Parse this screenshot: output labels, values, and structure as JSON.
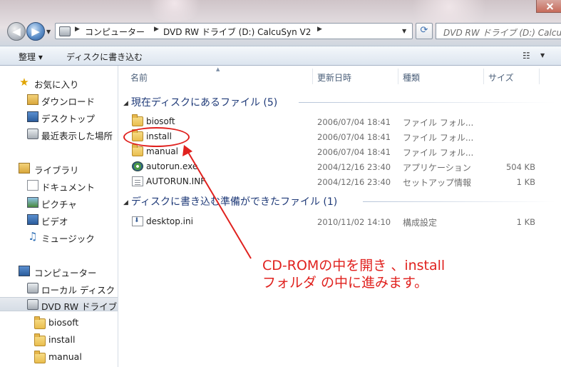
{
  "window": {
    "close_glyph": "close-icon"
  },
  "nav_buttons": {
    "back": "back-arrow-icon",
    "forward": "forward-arrow-icon"
  },
  "address_bar": {
    "crumbs": [
      "コンピューター",
      "DVD RW ドライブ (D:) CalcuSyn V2"
    ]
  },
  "search": {
    "placeholder": "DVD RW ドライブ (D:) Calcu"
  },
  "command_bar": {
    "organize": "整理 ▾",
    "burn": "ディスクに書き込む"
  },
  "nav_pane": {
    "favorites": "お気に入り",
    "favorites_items": [
      "ダウンロード",
      "デスクトップ",
      "最近表示した場所"
    ],
    "libraries": "ライブラリ",
    "library_items": [
      "ドキュメント",
      "ピクチャ",
      "ビデオ",
      "ミュージック"
    ],
    "computer": "コンピューター",
    "computer_items": [
      "ローカル ディスク (",
      "DVD RW ドライブ"
    ],
    "dvd_children": [
      "biosoft",
      "install",
      "manual"
    ]
  },
  "columns": {
    "name": "名前",
    "date": "更新日時",
    "type": "種類",
    "size": "サイズ"
  },
  "groups": [
    {
      "title": "現在ディスクにあるファイル (5)",
      "files": [
        {
          "name": "biosoft",
          "date": "2006/07/04 18:41",
          "type": "ファイル フォル...",
          "size": "",
          "icon": "folder"
        },
        {
          "name": "install",
          "date": "2006/07/04 18:41",
          "type": "ファイル フォル...",
          "size": "",
          "icon": "folder"
        },
        {
          "name": "manual",
          "date": "2006/07/04 18:41",
          "type": "ファイル フォル...",
          "size": "",
          "icon": "folder"
        },
        {
          "name": "autorun.exe",
          "date": "2004/12/16 23:40",
          "type": "アプリケーション",
          "size": "504 KB",
          "icon": "exe"
        },
        {
          "name": "AUTORUN.INF",
          "date": "2004/12/16 23:40",
          "type": "セットアップ情報",
          "size": "1 KB",
          "icon": "inf"
        }
      ]
    },
    {
      "title": "ディスクに書き込む準備ができたファイル (1)",
      "files": [
        {
          "name": "desktop.ini",
          "date": "2010/11/02 14:10",
          "type": "構成設定",
          "size": "1 KB",
          "icon": "ini"
        }
      ]
    }
  ],
  "annotation": {
    "line1": "CD-ROMの中を開き 、install",
    "line2": "フォルダ の中に進みます。",
    "color": "#e0211e"
  }
}
